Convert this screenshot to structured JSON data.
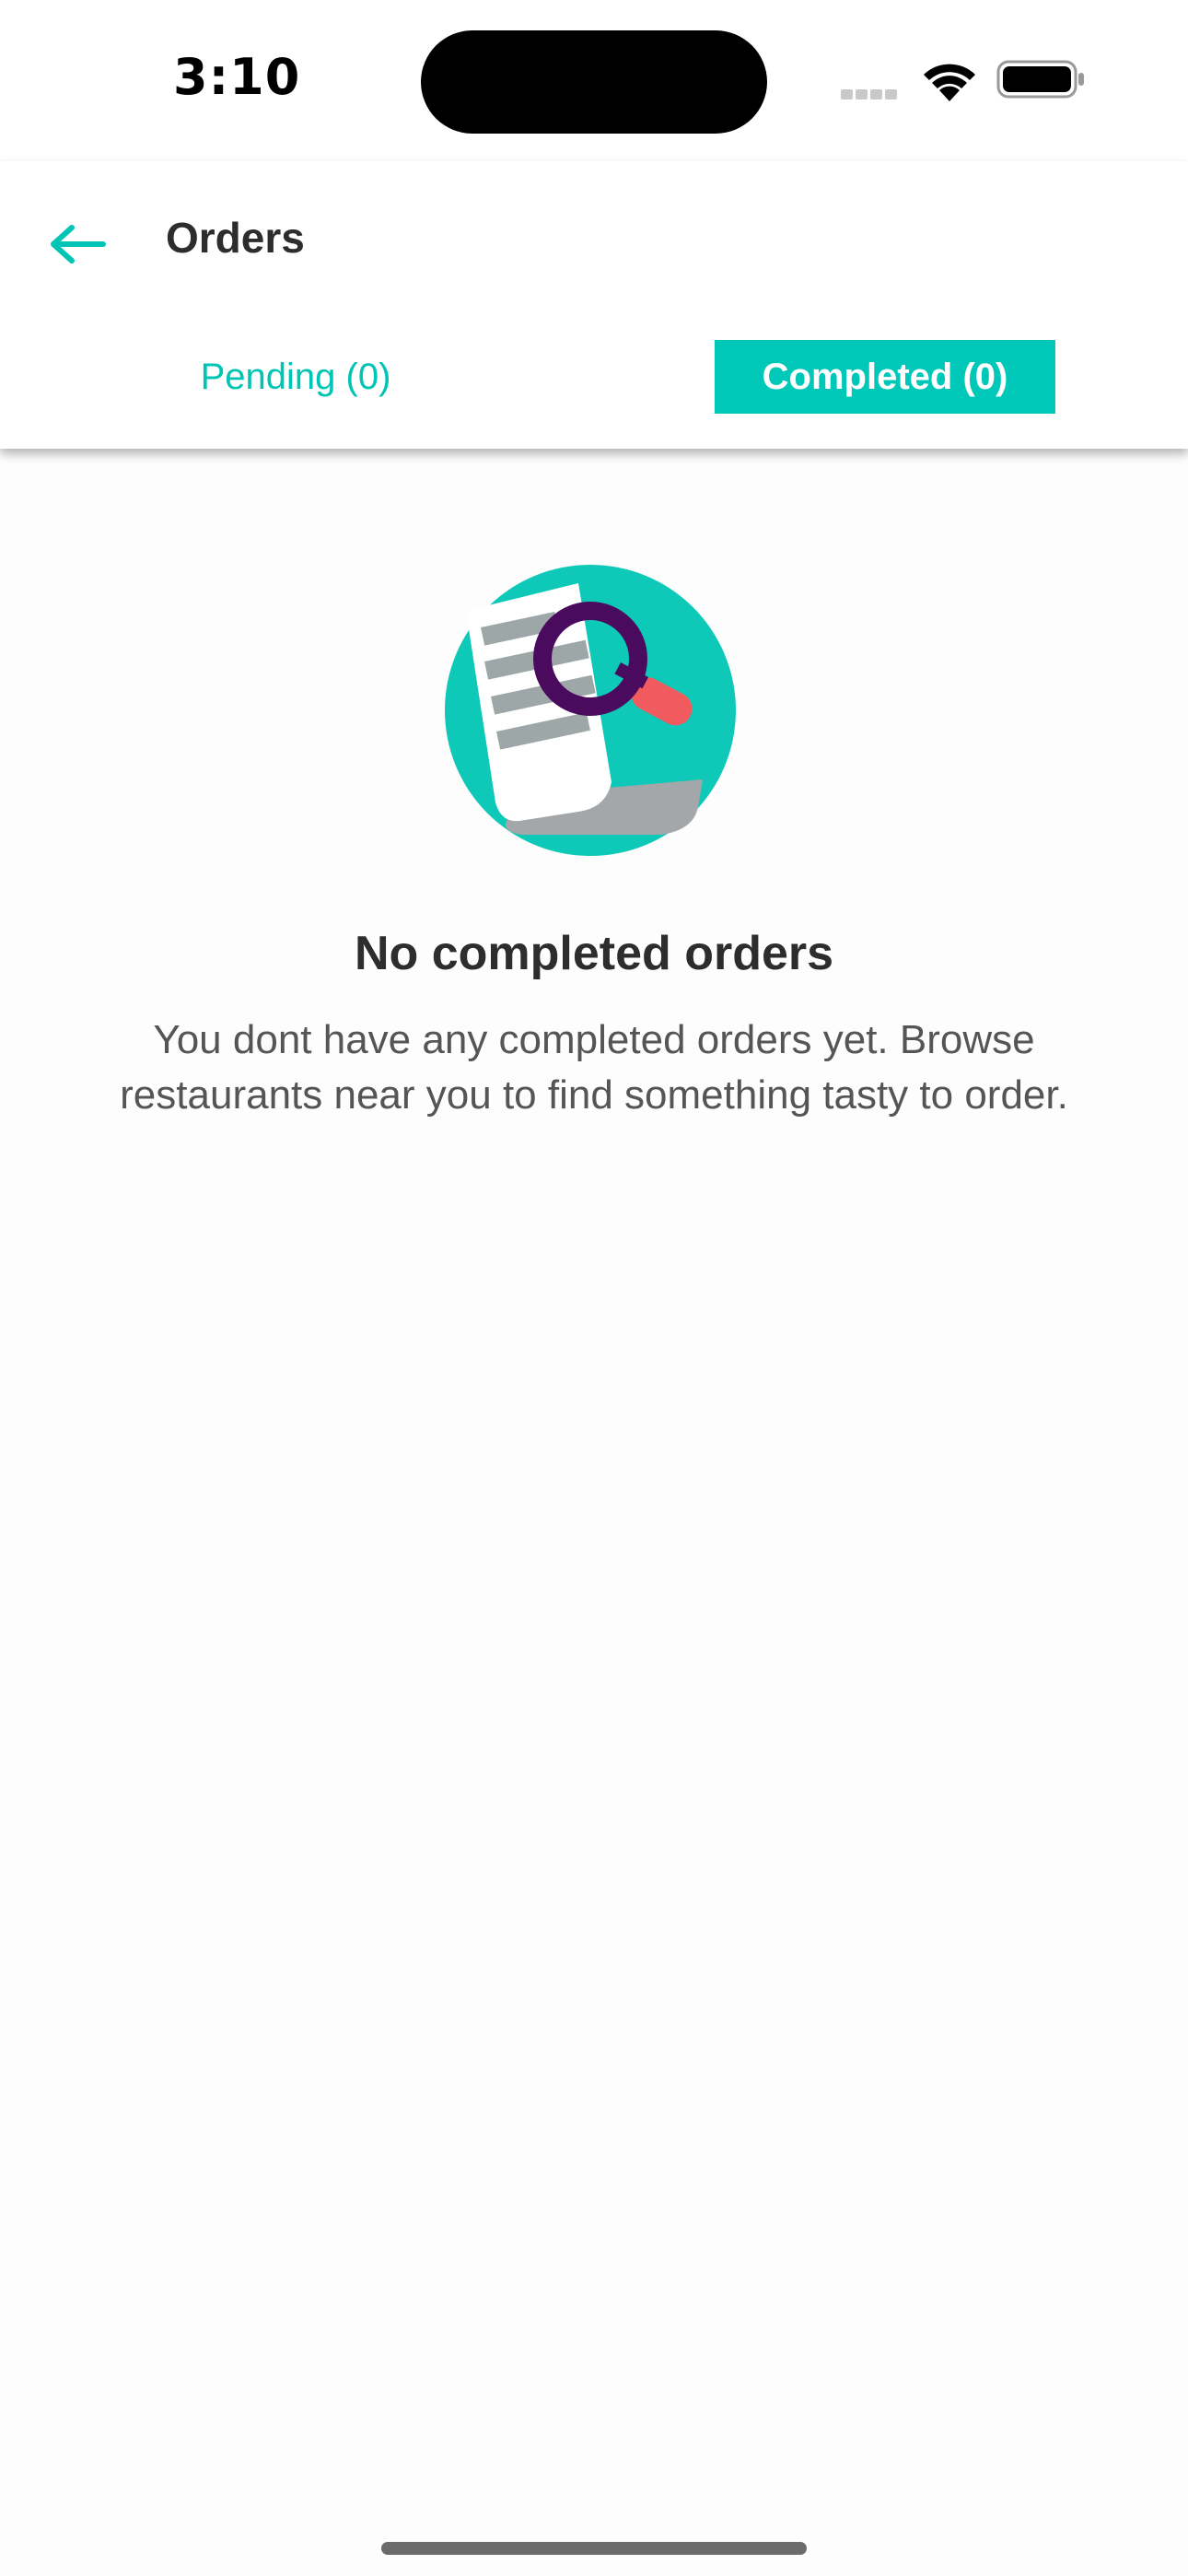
{
  "status_bar": {
    "time": "3:10"
  },
  "header": {
    "title": "Orders",
    "back_icon": "arrow-left-icon"
  },
  "tabs": [
    {
      "label": "Pending (0)",
      "selected": false
    },
    {
      "label": "Completed (0)",
      "selected": true
    }
  ],
  "empty_state": {
    "illustration": "receipt-magnifier-illustration",
    "title": "No completed orders",
    "message": "You dont have any completed orders yet. Browse restaurants near you to find something tasty to order."
  },
  "colors": {
    "accent": "#00c8b8",
    "title_text": "#2d2d2d",
    "body_text": "#555555",
    "illustration_magnifier": "#4a0a5e",
    "illustration_handle": "#f15a5f"
  }
}
